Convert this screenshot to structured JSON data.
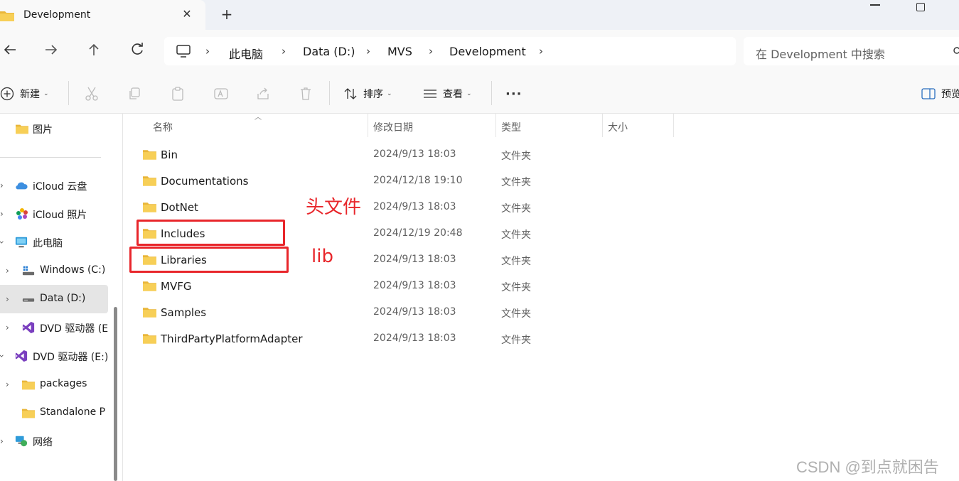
{
  "window": {
    "tab_title": "Development",
    "tab_close": "✕",
    "new_tab": "+"
  },
  "address": {
    "crumbs": [
      "此电脑",
      "Data (D:)",
      "MVS",
      "Development"
    ],
    "separator": "›"
  },
  "search": {
    "placeholder": "在 Development 中搜索"
  },
  "commands": {
    "new_label": "新建",
    "sort_label": "排序",
    "view_label": "查看",
    "more_label": "···",
    "preview_label": "预览",
    "caret": "⌄"
  },
  "sidebar": {
    "items": [
      {
        "label": "图片",
        "icon": "folder-icon"
      },
      {
        "label": "iCloud 云盘",
        "icon": "icloud-icon"
      },
      {
        "label": "iCloud 照片",
        "icon": "icloud-photos-icon"
      },
      {
        "label": "此电脑",
        "icon": "this-pc-icon"
      },
      {
        "label": "Windows (C:)",
        "icon": "windows-drive-icon"
      },
      {
        "label": "Data (D:)",
        "icon": "drive-icon"
      },
      {
        "label": "DVD 驱动器 (E",
        "icon": "visual-studio-icon"
      },
      {
        "label": "DVD 驱动器 (E:)",
        "icon": "visual-studio-icon"
      },
      {
        "label": "packages",
        "icon": "folder-icon"
      },
      {
        "label": "Standalone P",
        "icon": "folder-icon"
      },
      {
        "label": "网络",
        "icon": "network-icon"
      }
    ]
  },
  "columns": {
    "name": "名称",
    "modified": "修改日期",
    "type": "类型",
    "size": "大小"
  },
  "files": [
    {
      "name": "Bin",
      "modified": "2024/9/13 18:03",
      "type": "文件夹"
    },
    {
      "name": "Documentations",
      "modified": "2024/12/18 19:10",
      "type": "文件夹"
    },
    {
      "name": "DotNet",
      "modified": "2024/9/13 18:03",
      "type": "文件夹"
    },
    {
      "name": "Includes",
      "modified": "2024/12/19 20:48",
      "type": "文件夹"
    },
    {
      "name": "Libraries",
      "modified": "2024/9/13 18:03",
      "type": "文件夹"
    },
    {
      "name": "MVFG",
      "modified": "2024/9/13 18:03",
      "type": "文件夹"
    },
    {
      "name": "Samples",
      "modified": "2024/9/13 18:03",
      "type": "文件夹"
    },
    {
      "name": "ThirdPartyPlatformAdapter",
      "modified": "2024/9/13 18:03",
      "type": "文件夹"
    }
  ],
  "annotations": {
    "includes_note": "头文件",
    "libraries_note": "lib"
  },
  "watermark": "CSDN @到点就困告",
  "colors": {
    "folder": "#f4c542",
    "annotation": "#e8262b",
    "selected": "#e5e5e5"
  }
}
